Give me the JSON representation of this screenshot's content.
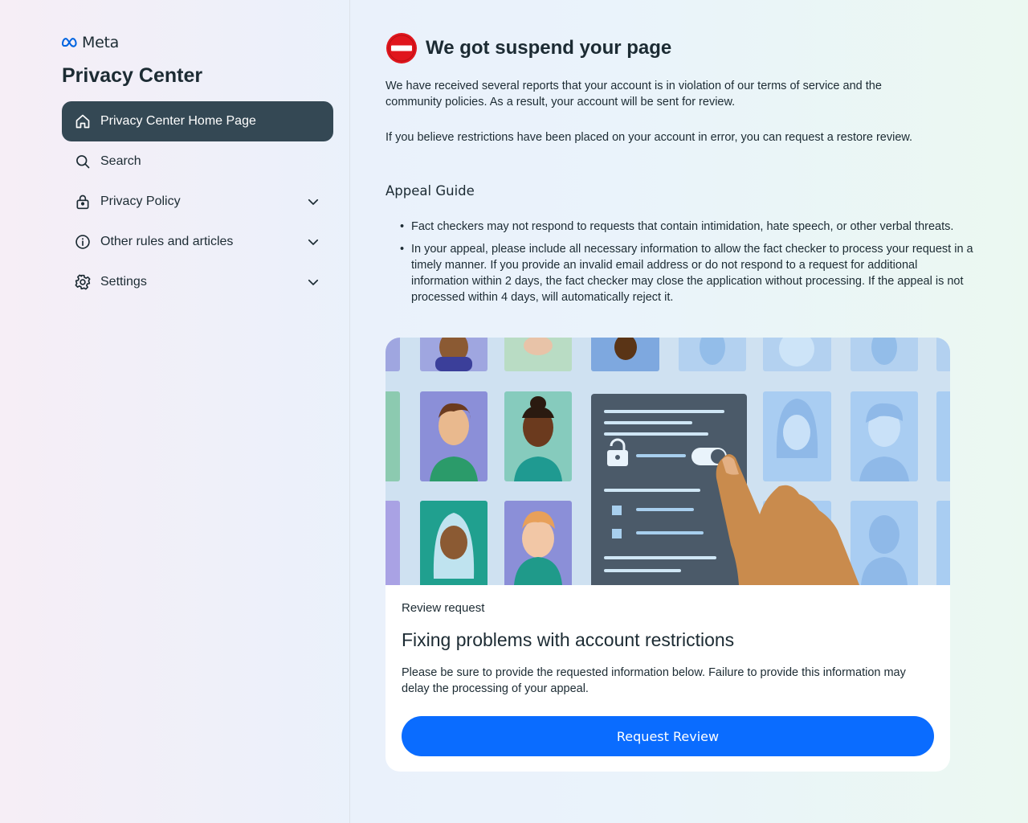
{
  "brand": {
    "name": "Meta",
    "logo_color": "#0064e0"
  },
  "sidebar": {
    "title": "Privacy Center",
    "items": [
      {
        "label": "Privacy Center Home Page",
        "icon": "home-icon",
        "active": true
      },
      {
        "label": "Search",
        "icon": "search-icon"
      },
      {
        "label": "Privacy Policy",
        "icon": "lock-icon",
        "expandable": true
      },
      {
        "label": "Other rules and articles",
        "icon": "info-icon",
        "expandable": true
      },
      {
        "label": "Settings",
        "icon": "gear-icon",
        "expandable": true
      }
    ]
  },
  "main": {
    "title": "We got suspend your page",
    "status_icon": "no-entry-icon",
    "paragraph1": "We have received several reports that your account is in violation of our terms of service and the community policies. As a result, your account will be sent for review.",
    "paragraph2": "If you believe restrictions have been placed on your account in error, you can request a restore review.",
    "guide_title": "Appeal Guide",
    "guide_items": [
      "Fact checkers may not respond to requests that contain intimidation, hate speech, or other verbal threats.",
      "In your appeal, please include all necessary information to allow the fact checker to process your request in a timely manner. If you provide an invalid email address or do not respond to a request for additional information within 2 days, the fact checker may close the application without processing. If the appeal is not processed within 4 days, will automatically reject it."
    ]
  },
  "card": {
    "kicker": "Review request",
    "title": "Fixing problems with account restrictions",
    "text": "Please be sure to provide the requested information below. Failure to provide this information may delay the processing of your appeal.",
    "button_label": "Request Review",
    "button_color": "#0a6cff"
  }
}
